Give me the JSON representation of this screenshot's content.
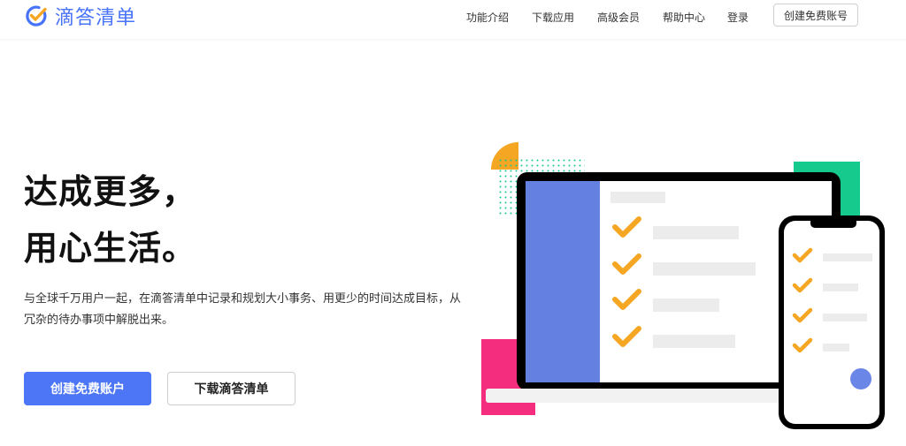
{
  "brand": {
    "name": "滴答清单",
    "accent_color": "#4772fa",
    "logo_check_color": "#f5a623"
  },
  "nav": {
    "items": [
      "功能介绍",
      "下载应用",
      "高级会员",
      "帮助中心",
      "登录"
    ],
    "signup_button": "创建免费账号"
  },
  "hero": {
    "headline_line1": "达成更多，",
    "headline_line2": "用心生活。",
    "description_line1": "与全球千万用户一起，在滴答清单中记录和规划大小事务、用更少的时间达成目标，从",
    "description_line2": "冗杂的待办事项中解脱出来。",
    "primary_button": "创建免费账户",
    "secondary_button": "下载滴答清单"
  },
  "illustration": {
    "icon": "laptop-and-phone-checklist-illustration",
    "sidebar_color": "#6480e0",
    "check_color": "#f5a623",
    "bar_color": "#ececec",
    "green_accent": "#16c98d",
    "pink_accent": "#f52d7f",
    "yellow_accent": "#f5a623",
    "avatar_color": "#6a86e6",
    "laptop_check_count": 4,
    "phone_check_count": 4
  }
}
